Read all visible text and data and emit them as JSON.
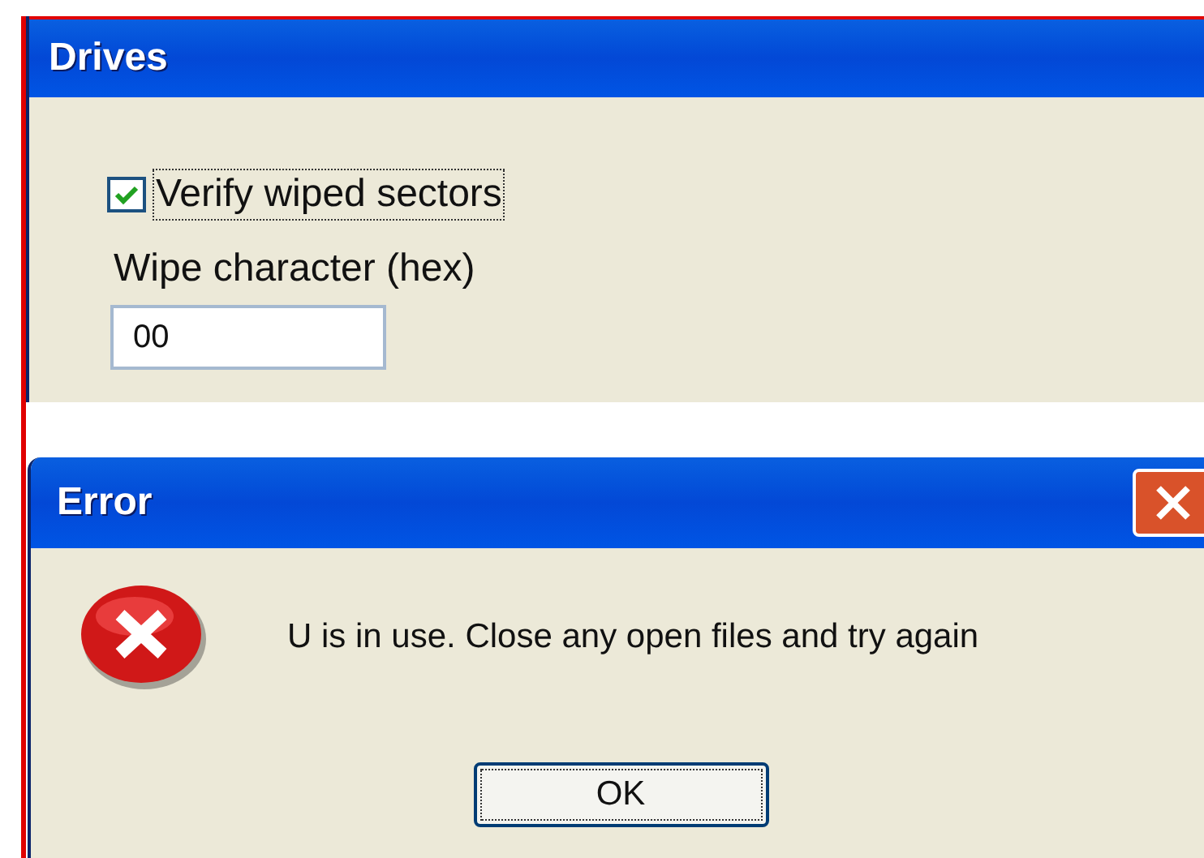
{
  "drives_window": {
    "title": "Drives",
    "verify_checkbox": {
      "label": "Verify wiped sectors",
      "checked": true
    },
    "wipe_field": {
      "label": "Wipe character (hex)",
      "value": "00"
    }
  },
  "error_dialog": {
    "title": "Error",
    "message": "U is in use. Close any open files and try again",
    "buttons": [
      "OK"
    ]
  }
}
